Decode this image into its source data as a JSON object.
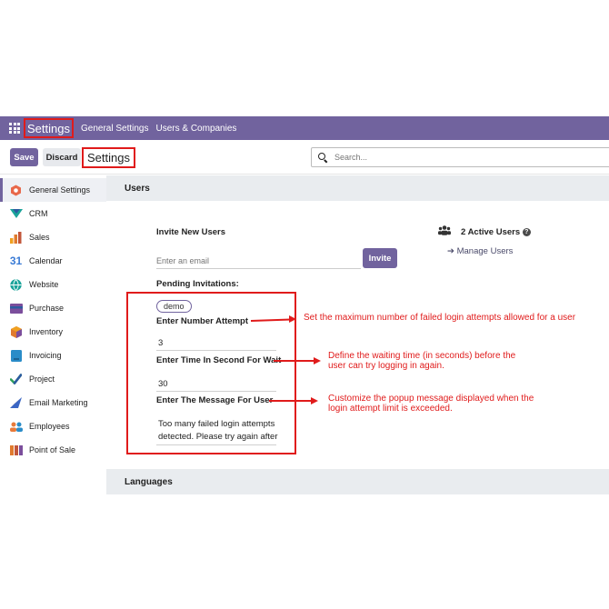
{
  "topbar": {
    "app_title": "Settings",
    "nav": [
      "General Settings",
      "Users & Companies"
    ]
  },
  "controls": {
    "save_label": "Save",
    "discard_label": "Discard",
    "breadcrumb": "Settings",
    "search_placeholder": "Search..."
  },
  "sidebar": {
    "items": [
      {
        "label": "General Settings",
        "icon": "general-settings-icon",
        "color": "#e8684a"
      },
      {
        "label": "CRM",
        "icon": "crm-icon",
        "color": "#1aa39a"
      },
      {
        "label": "Sales",
        "icon": "sales-icon",
        "color": "#f0a020"
      },
      {
        "label": "Calendar",
        "icon": "calendar-icon",
        "color": "#3a7bd5"
      },
      {
        "label": "Website",
        "icon": "website-icon",
        "color": "#1aa39a"
      },
      {
        "label": "Purchase",
        "icon": "purchase-icon",
        "color": "#7b4e9c"
      },
      {
        "label": "Inventory",
        "icon": "inventory-icon",
        "color": "#e07a2e"
      },
      {
        "label": "Invoicing",
        "icon": "invoicing-icon",
        "color": "#2a8cc8"
      },
      {
        "label": "Project",
        "icon": "project-icon",
        "color": "#2d9e5a"
      },
      {
        "label": "Email Marketing",
        "icon": "email-marketing-icon",
        "color": "#3a66c4"
      },
      {
        "label": "Employees",
        "icon": "employees-icon",
        "color": "#e87a3a"
      },
      {
        "label": "Point of Sale",
        "icon": "point-of-sale-icon",
        "color": "#c2563a"
      }
    ],
    "calendar_glyph": "31"
  },
  "users_section": {
    "heading": "Users",
    "invite_label": "Invite New Users",
    "invite_placeholder": "Enter an email",
    "invite_button": "Invite",
    "pending_label": "Pending Invitations:",
    "pending_tag": "demo",
    "attempt_label": "Enter Number Attempt",
    "attempt_value": "3",
    "wait_label": "Enter Time In Second For Wait",
    "wait_value": "30",
    "message_label": "Enter The Message For User",
    "message_line1": "Too many failed login attempts",
    "message_line2": "detected. Please try again after",
    "active_users": "2 Active Users",
    "help_glyph": "?",
    "manage_users": "Manage Users",
    "manage_arrow": "➔"
  },
  "languages_section": {
    "heading": "Languages"
  },
  "annotations": {
    "attempt": "Set the maximum number of failed login attempts allowed for a user",
    "wait_line1": "Define the waiting time (in seconds) before the",
    "wait_line2": "user can try logging in again.",
    "message_line1": "Customize the popup message displayed when the",
    "message_line2": "login attempt limit is exceeded."
  },
  "colors": {
    "brand": "#71639e",
    "highlight": "#e01b1b"
  }
}
